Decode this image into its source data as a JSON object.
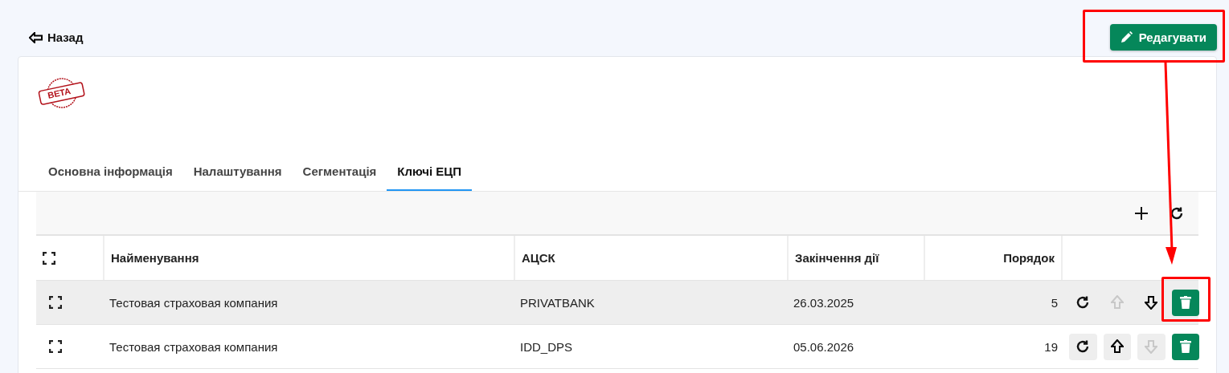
{
  "back_link": {
    "label": "Назад"
  },
  "edit_button": {
    "label": "Редагувати"
  },
  "badge": {
    "label": "BETA"
  },
  "tabs": [
    {
      "label": "Основна інформація",
      "selected": false
    },
    {
      "label": "Налаштування",
      "selected": false
    },
    {
      "label": "Сегментація",
      "selected": false
    },
    {
      "label": "Ключі ЕЦП",
      "selected": true
    }
  ],
  "table": {
    "columns": [
      "Найменування",
      "АЦСК",
      "Закінчення дії",
      "Порядок"
    ],
    "rows": [
      {
        "name": "Тестовая страховая компания",
        "acsk": "PRIVATBANK",
        "expires": "26.03.2025",
        "order": "5",
        "highlighted": true,
        "up_disabled": true,
        "down_disabled": false
      },
      {
        "name": "Тестовая страховая компания",
        "acsk": "IDD_DPS",
        "expires": "05.06.2026",
        "order": "19",
        "highlighted": false,
        "up_disabled": false,
        "down_disabled": true
      }
    ]
  }
}
